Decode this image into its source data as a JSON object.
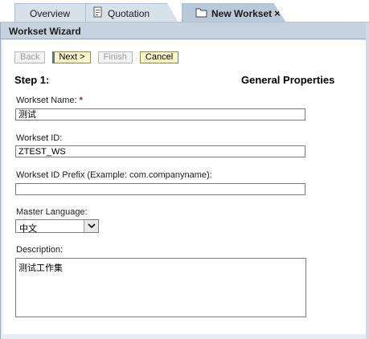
{
  "tabs": [
    {
      "label": "Overview",
      "icon": "none"
    },
    {
      "label": "Quotation",
      "icon": "document-icon"
    },
    {
      "label": "New Workset",
      "icon": "folder-icon",
      "close": "×"
    }
  ],
  "panel": {
    "title": "Workset Wizard"
  },
  "buttons": {
    "back": "Back",
    "next": "Next >",
    "finish": "Finish",
    "cancel": "Cancel"
  },
  "step": {
    "label": "Step 1:",
    "title": "General Properties"
  },
  "form": {
    "name_label": "Workset Name:",
    "required_mark": "*",
    "name_value": "测试",
    "id_label": "Workset ID:",
    "id_value": "ZTEST_WS",
    "prefix_label": "Workset ID Prefix (Example: com.companyname):",
    "prefix_value": "",
    "language_label": "Master Language:",
    "language_value": "中文",
    "description_label": "Description:",
    "description_value": "测试工作集"
  },
  "colors": {
    "tab_active": "#b9c9da",
    "panel_header": "#c6d3df",
    "button_active": "#fbf5c8",
    "required": "#c0151c"
  }
}
